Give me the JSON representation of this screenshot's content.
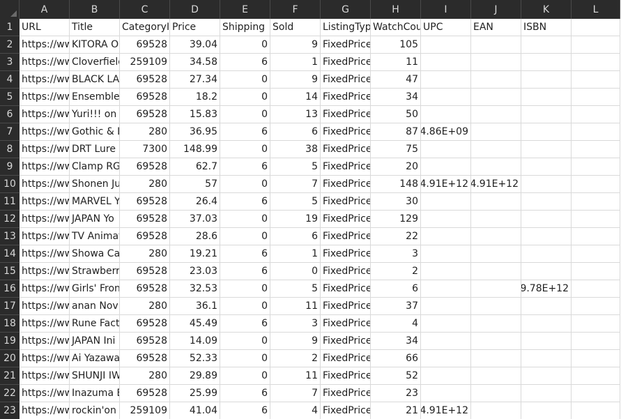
{
  "columns": [
    "A",
    "B",
    "C",
    "D",
    "E",
    "F",
    "G",
    "H",
    "I",
    "J",
    "K",
    "L"
  ],
  "headers": [
    "URL",
    "Title",
    "CategoryID",
    "Price",
    "Shipping",
    "Sold",
    "ListingType",
    "WatchCount",
    "UPC",
    "EAN",
    "ISBN",
    ""
  ],
  "rows": [
    [
      "https://www",
      "KITORA O",
      "69528",
      "39.04",
      "0",
      "9",
      "FixedPrice",
      "105",
      "",
      "",
      ""
    ],
    [
      "https://www",
      "Cloverfield",
      "259109",
      "34.58",
      "6",
      "1",
      "FixedPrice",
      "11",
      "",
      "",
      ""
    ],
    [
      "https://www",
      "BLACK LA",
      "69528",
      "27.34",
      "0",
      "9",
      "FixedPrice",
      "47",
      "",
      "",
      ""
    ],
    [
      "https://www",
      "Ensemble",
      "69528",
      "18.2",
      "0",
      "14",
      "FixedPrice",
      "34",
      "",
      "",
      ""
    ],
    [
      "https://www",
      "Yuri!!! on",
      "69528",
      "15.83",
      "0",
      "13",
      "FixedPrice",
      "50",
      "",
      "",
      ""
    ],
    [
      "https://www",
      "Gothic & L",
      "280",
      "36.95",
      "6",
      "6",
      "FixedPrice",
      "87",
      "4.86E+09",
      "",
      ""
    ],
    [
      "https://www",
      "DRT Lure",
      "7300",
      "148.99",
      "0",
      "38",
      "FixedPrice",
      "75",
      "",
      "",
      ""
    ],
    [
      "https://www",
      "Clamp RG",
      "69528",
      "62.7",
      "6",
      "5",
      "FixedPrice",
      "20",
      "",
      "",
      ""
    ],
    [
      "https://www",
      "Shonen Ju",
      "280",
      "57",
      "0",
      "7",
      "FixedPrice",
      "148",
      "4.91E+12",
      "4.91E+12",
      ""
    ],
    [
      "https://www",
      "MARVEL Y",
      "69528",
      "26.4",
      "6",
      "5",
      "FixedPrice",
      "30",
      "",
      "",
      ""
    ],
    [
      "https://www",
      "JAPAN Yo",
      "69528",
      "37.03",
      "0",
      "19",
      "FixedPrice",
      "129",
      "",
      "",
      ""
    ],
    [
      "https://www",
      "TV Animat",
      "69528",
      "28.6",
      "0",
      "6",
      "FixedPrice",
      "22",
      "",
      "",
      ""
    ],
    [
      "https://www",
      "Showa Ca",
      "280",
      "19.21",
      "6",
      "1",
      "FixedPrice",
      "3",
      "",
      "",
      ""
    ],
    [
      "https://www",
      "Strawberry",
      "69528",
      "23.03",
      "6",
      "0",
      "FixedPrice",
      "2",
      "",
      "",
      ""
    ],
    [
      "https://www",
      "Girls' Fron",
      "69528",
      "32.53",
      "0",
      "5",
      "FixedPrice",
      "6",
      "",
      "",
      "9.78E+12"
    ],
    [
      "https://www",
      "anan Nov",
      "280",
      "36.1",
      "0",
      "11",
      "FixedPrice",
      "37",
      "",
      "",
      ""
    ],
    [
      "https://www",
      "Rune Fact",
      "69528",
      "45.49",
      "6",
      "3",
      "FixedPrice",
      "4",
      "",
      "",
      ""
    ],
    [
      "https://www",
      "JAPAN Ini",
      "69528",
      "14.09",
      "0",
      "9",
      "FixedPrice",
      "34",
      "",
      "",
      ""
    ],
    [
      "https://www",
      "Ai Yazawa",
      "69528",
      "52.33",
      "0",
      "2",
      "FixedPrice",
      "66",
      "",
      "",
      ""
    ],
    [
      "https://www",
      "SHUNJI IW",
      "280",
      "29.89",
      "0",
      "11",
      "FixedPrice",
      "52",
      "",
      "",
      ""
    ],
    [
      "https://www",
      "Inazuma E",
      "69528",
      "25.99",
      "6",
      "7",
      "FixedPrice",
      "23",
      "",
      "",
      ""
    ],
    [
      "https://www",
      "rockin'on .",
      "259109",
      "41.04",
      "6",
      "4",
      "FixedPrice",
      "21",
      "4.91E+12",
      "",
      ""
    ]
  ],
  "row_numbers": [
    "1",
    "2",
    "3",
    "4",
    "5",
    "6",
    "7",
    "8",
    "9",
    "10",
    "11",
    "12",
    "13",
    "14",
    "15",
    "16",
    "17",
    "18",
    "19",
    "20",
    "21",
    "22",
    "23"
  ]
}
